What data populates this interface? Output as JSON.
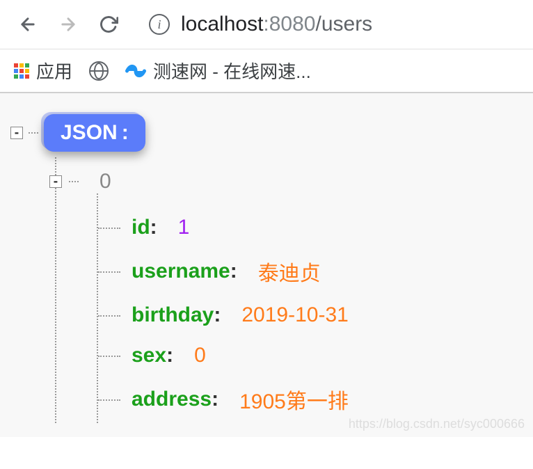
{
  "browser": {
    "url_host": "localhost",
    "url_port": ":8080",
    "url_path": "/users"
  },
  "bookmarks": {
    "apps_label": "应用",
    "speedtest_label": "测速网 - 在线网速..."
  },
  "json_viewer": {
    "root_label": "JSON",
    "root_colon": ":",
    "toggle_collapse": "-",
    "index0": "0",
    "items": [
      {
        "key": "id",
        "value": "1",
        "type": "num"
      },
      {
        "key": "username",
        "value": "泰迪贞",
        "type": "str"
      },
      {
        "key": "birthday",
        "value": "2019-10-31",
        "type": "str"
      },
      {
        "key": "sex",
        "value": "0",
        "type": "str"
      },
      {
        "key": "address",
        "value": "1905第一排",
        "type": "str"
      }
    ]
  },
  "watermark": "https://blog.csdn.net/syc000666"
}
